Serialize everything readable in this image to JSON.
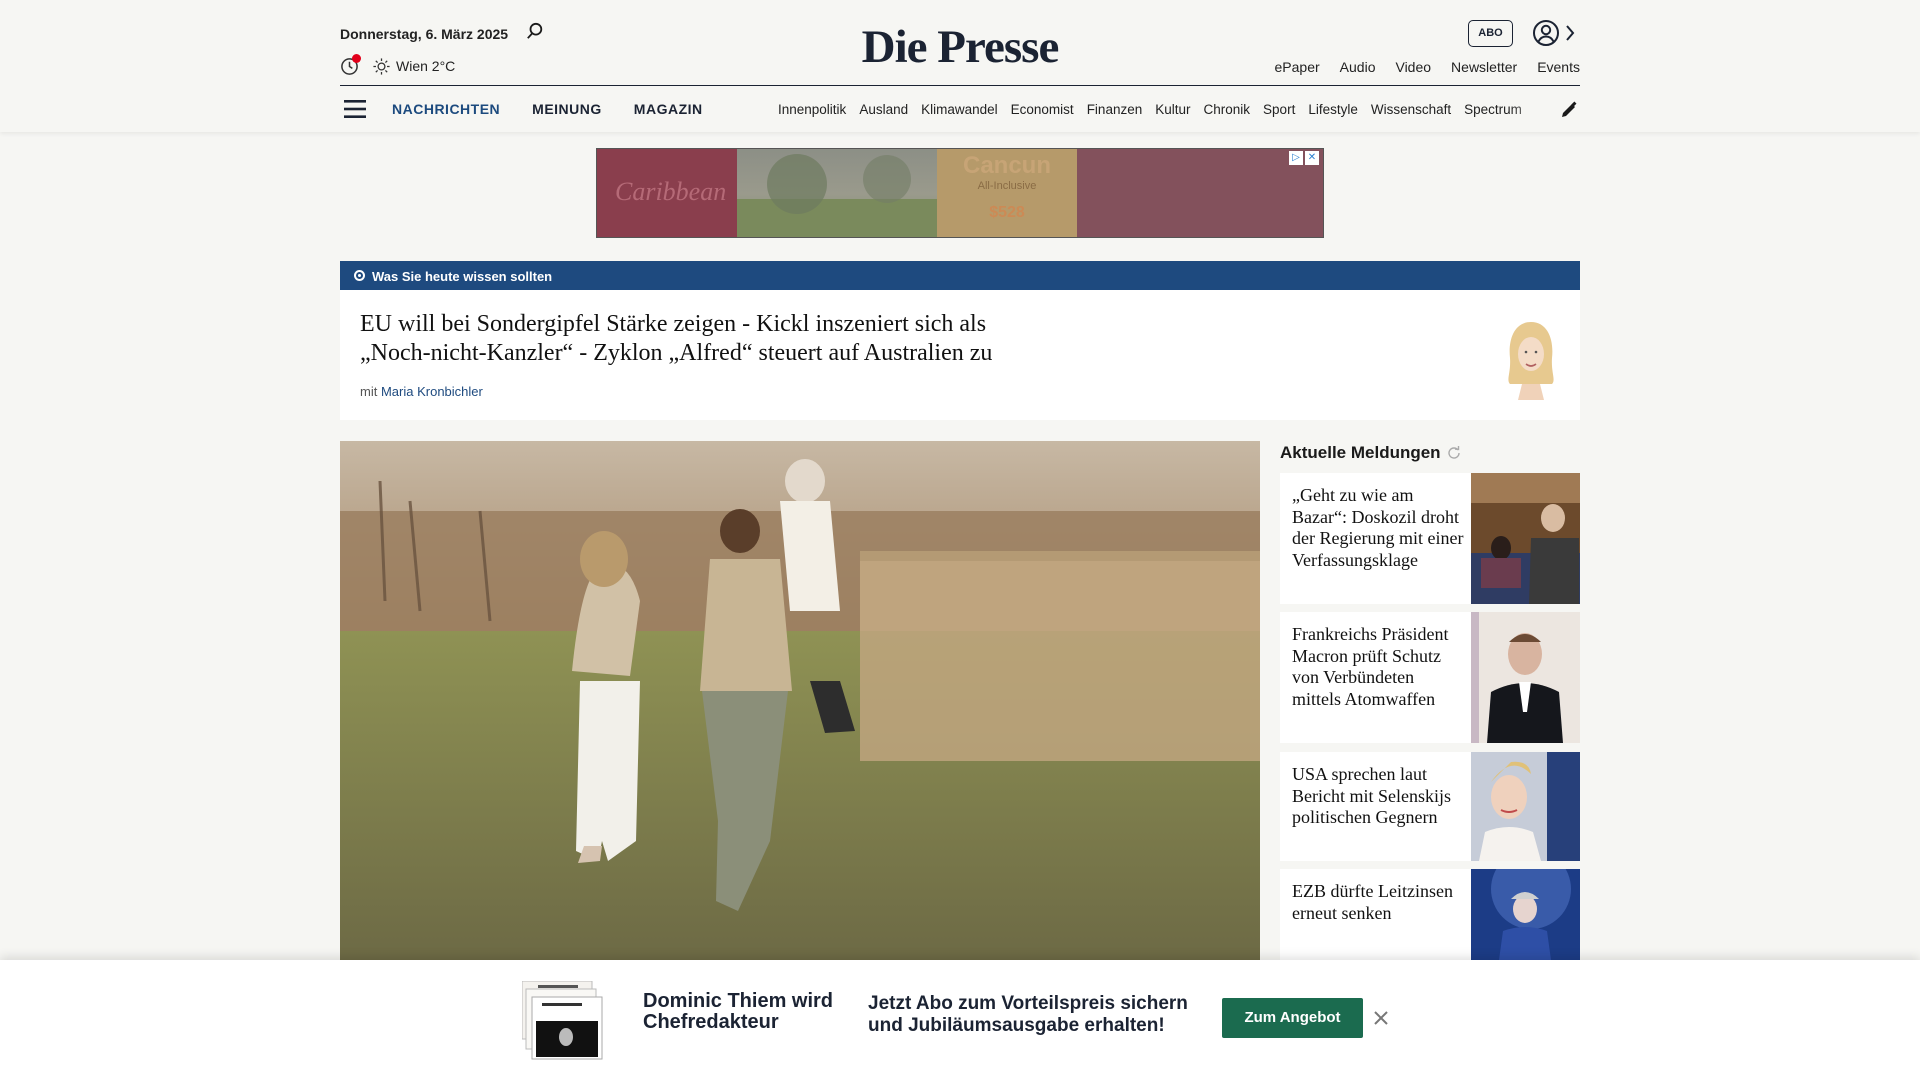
{
  "header": {
    "date": "Donnerstag, 6. März 2025",
    "weather": "Wien 2°C",
    "logo": "Die Presse",
    "abo_label": "ABO",
    "top_links": [
      "ePaper",
      "Audio",
      "Video",
      "Newsletter",
      "Events"
    ],
    "main_nav": [
      "NACHRICHTEN",
      "MEINUNG",
      "MAGAZIN"
    ],
    "sub_nav": [
      "Innenpolitik",
      "Ausland",
      "Klimawandel",
      "Economist",
      "Finanzen",
      "Kultur",
      "Chronik",
      "Sport",
      "Lifestyle",
      "Wissenschaft",
      "Spectrum"
    ]
  },
  "ad": {
    "brand": "Caribbean",
    "offer_title": "Cancun",
    "offer_sub": "All-Inclusive",
    "offer_price": "$528"
  },
  "briefing": {
    "label": "Was Sie heute wissen sollten",
    "title": "EU will bei Sondergipfel Stärke zeigen - Kickl inszeniert sich als „Noch-nicht-Kanzler“ - Zyklon „Alfred“ steuert auf Australien zu",
    "by_prefix": "mit",
    "author": "Maria Kronbichler"
  },
  "sidebar": {
    "title": "Aktuelle Meldungen",
    "items": [
      {
        "headline": "„Geht zu wie am Bazar“: Doskozil droht der Regierung mit einer Verfassungsklage"
      },
      {
        "headline": "Frankreichs Präsident Macron prüft Schutz von Verbündeten mittels Atomwaffen"
      },
      {
        "headline": "USA sprechen laut Bericht mit Selenskijs politischen Gegnern"
      },
      {
        "headline": "EZB dürfte Leitzinsen erneut senken"
      }
    ]
  },
  "banner": {
    "headline": "Dominic Thiem wird Chefredakteur",
    "text": "Jetzt Abo zum Vorteilspreis sichern und Jubiläumsausgabe erhalten!",
    "button": "Zum Angebot"
  },
  "colors": {
    "brand_blue": "#1e4a7f",
    "nav_active": "#1c4a7e",
    "cta_green": "#1b6b4f",
    "notif_red": "#e2001a"
  }
}
